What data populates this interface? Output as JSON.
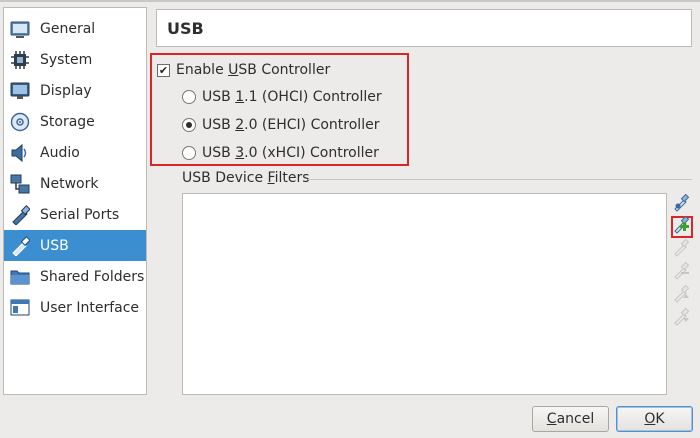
{
  "sidebar": {
    "items": [
      {
        "label": "General",
        "icon": "general-icon"
      },
      {
        "label": "System",
        "icon": "system-icon"
      },
      {
        "label": "Display",
        "icon": "display-icon"
      },
      {
        "label": "Storage",
        "icon": "storage-icon"
      },
      {
        "label": "Audio",
        "icon": "audio-icon"
      },
      {
        "label": "Network",
        "icon": "network-icon"
      },
      {
        "label": "Serial Ports",
        "icon": "serial-ports-icon"
      },
      {
        "label": "USB",
        "icon": "usb-icon",
        "selected": true
      },
      {
        "label": "Shared Folders",
        "icon": "shared-folders-icon"
      },
      {
        "label": "User Interface",
        "icon": "user-interface-icon"
      }
    ]
  },
  "header": {
    "title": "USB"
  },
  "usb": {
    "enable_label_pre": "Enable ",
    "enable_label_u": "U",
    "enable_label_post": "SB Controller",
    "enabled": true,
    "options": [
      {
        "pre": "USB ",
        "u": "1",
        "post": ".1 (OHCI) Controller",
        "selected": false
      },
      {
        "pre": "USB ",
        "u": "2",
        "post": ".0 (EHCI) Controller",
        "selected": true
      },
      {
        "pre": "USB ",
        "u": "3",
        "post": ".0 (xHCI) Controller",
        "selected": false
      }
    ],
    "filters_pre": "USB Device ",
    "filters_u": "F",
    "filters_post": "ilters"
  },
  "tools": [
    "add-filter-icon",
    "add-from-device-icon",
    "edit-filter-icon",
    "remove-filter-icon",
    "move-up-icon",
    "move-down-icon"
  ],
  "buttons": {
    "cancel_u": "C",
    "cancel_rest": "ancel",
    "ok_u": "O",
    "ok_rest": "K"
  },
  "colors": {
    "accent": "#3b8ed0",
    "highlight": "#d8262a"
  }
}
